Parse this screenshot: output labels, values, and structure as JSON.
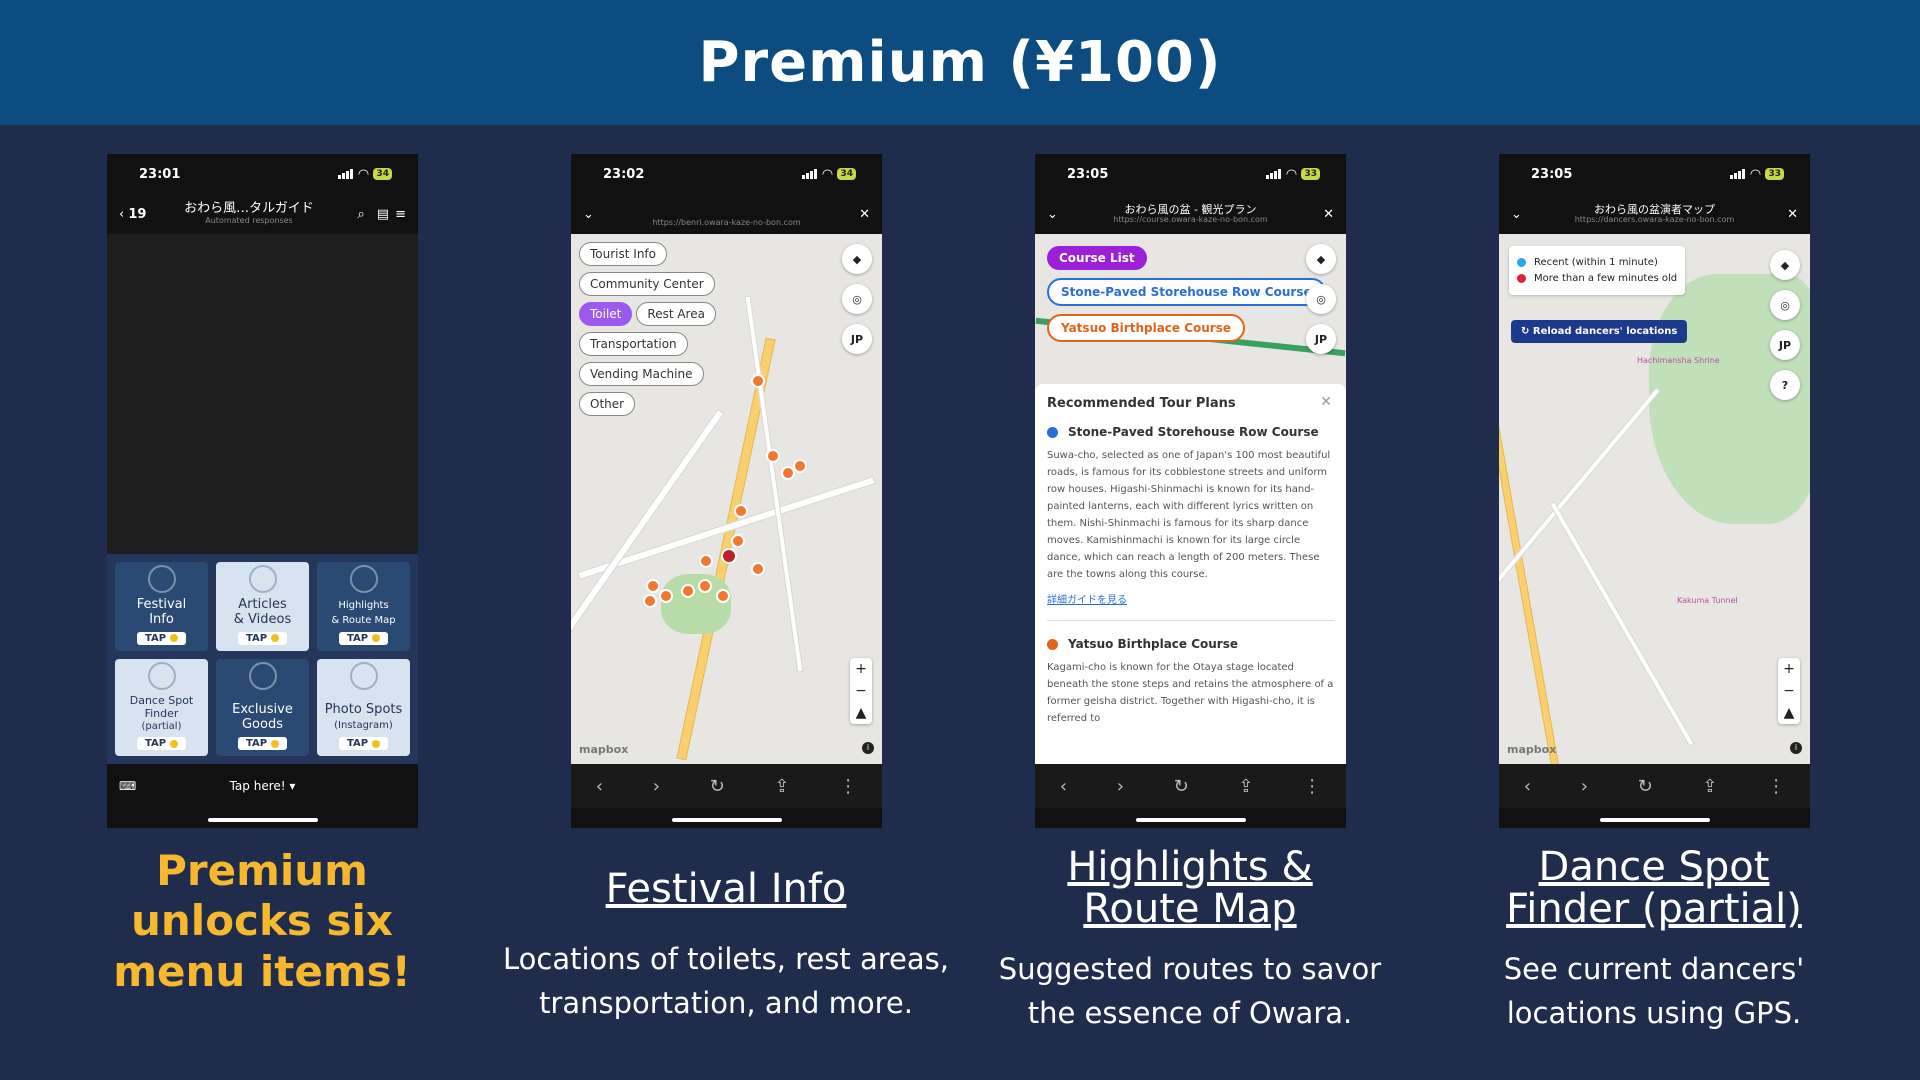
{
  "header": {
    "title": "Premium (¥100)"
  },
  "phones": {
    "p1": {
      "time": "23:01",
      "battery": "34",
      "back_count": "19",
      "chat_title": "おわら風…タルガイド",
      "chat_sub": "Automated responses",
      "menu": [
        {
          "label1": "Festival",
          "label2": "Info",
          "label3": "",
          "tap": "TAP"
        },
        {
          "label1": "Articles",
          "label2": "& Videos",
          "label3": "",
          "tap": "TAP"
        },
        {
          "label1": "Highlights",
          "label2": "& Route Map",
          "label3": "",
          "tap": "TAP"
        },
        {
          "label1": "Dance Spot",
          "label2": "Finder",
          "label3": "(partial)",
          "tap": "TAP"
        },
        {
          "label1": "Exclusive",
          "label2": "Goods",
          "label3": "",
          "tap": "TAP"
        },
        {
          "label1": "Photo Spots",
          "label2": "(Instagram)",
          "label3": "",
          "tap": "TAP"
        }
      ],
      "tap_here": "Tap here! ▾"
    },
    "p2": {
      "time": "23:02",
      "battery": "34",
      "url": "https://benri.owara-kaze-no-bon.com",
      "chips": [
        "Tourist Info",
        "Community Center",
        "Toilet",
        "Rest Area",
        "Transportation",
        "Vending Machine",
        "Other"
      ],
      "active_chip": "Toilet",
      "jp": "JP",
      "mapbox": "mapbox"
    },
    "p3": {
      "time": "23:05",
      "battery": "33",
      "title": "おわら風の盆 - 観光プラン",
      "url": "https://course.owara-kaze-no-bon.com",
      "btn_list": "Course List",
      "btn_blue": "Stone-Paved Storehouse Row Course",
      "btn_orange": "Yatsuo Birthplace Course",
      "jp": "JP",
      "sheet_title": "Recommended Tour Plans",
      "course1": "Stone-Paved Storehouse Row Course",
      "course1_desc": "Suwa-cho, selected as one of Japan's 100 most beautiful roads, is famous for its cobblestone streets and uniform row houses. Higashi-Shinmachi is known for its hand-painted lanterns, each with different lyrics written on them. Nishi-Shinmachi is famous for its sharp dance moves. Kamishinmachi is known for its large circle dance, which can reach a length of 200 meters. These are the towns along this course.",
      "guide_link": "詳細ガイドを見る",
      "course2": "Yatsuo Birthplace Course",
      "course2_desc": "Kagami-cho is known for the Otaya stage located beneath the stone steps and retains the atmosphere of a former geisha district. Together with Higashi-cho, it is referred to"
    },
    "p4": {
      "time": "23:05",
      "battery": "33",
      "title": "おわら風の盆演者マップ",
      "url": "https://dancers.owara-kaze-no-bon.com",
      "legend_recent": "Recent (within 1 minute)",
      "legend_old": "More than a few minutes old",
      "reload": "Reload dancers' locations",
      "jp": "JP",
      "help": "?",
      "place1": "Hachimansha Shrine",
      "place2": "Kakuma Tunnel",
      "mapbox": "mapbox"
    }
  },
  "captions": {
    "c1": "Premium unlocks six menu items!",
    "c2_title": "Festival Info",
    "c2_desc": "Locations of toilets, rest areas, transportation, and more.",
    "c3_title": "Highlights & Route Map",
    "c3_desc": "Suggested routes to savor the essence of Owara.",
    "c4_title": "Dance Spot Finder (partial)",
    "c4_desc": "See current dancers' locations using GPS."
  },
  "colors": {
    "background": "#1f2c4c",
    "header": "#0d4c80",
    "accent_yellow": "#f5b82e",
    "active_chip": "#9b59f0"
  }
}
